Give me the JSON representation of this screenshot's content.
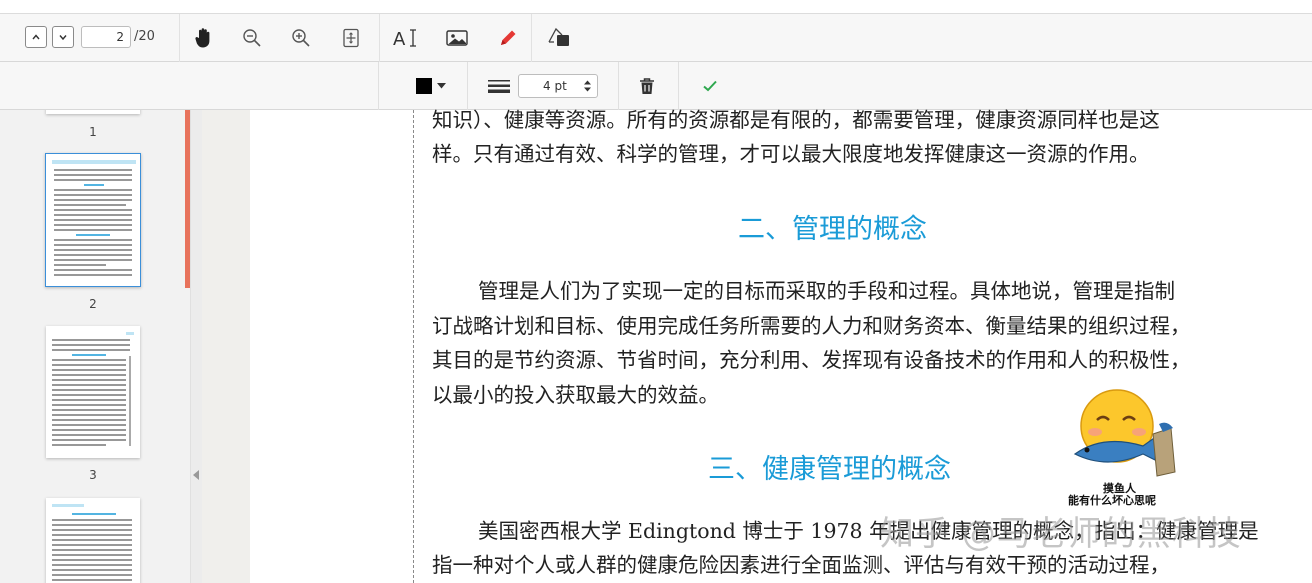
{
  "toolbar": {
    "page_current": "2",
    "page_total": "/20",
    "tools": [
      "prev-page",
      "next-page",
      "hand",
      "zoom-out",
      "zoom-in",
      "fit-page",
      "add-text",
      "add-image",
      "draw",
      "shape-fill"
    ]
  },
  "subtoolbar": {
    "stroke_color": "#000000",
    "stroke_width": "4 pt"
  },
  "sidebar": {
    "thumbnails": [
      {
        "label": "1"
      },
      {
        "label": "2"
      },
      {
        "label": "3"
      },
      {
        "label": ""
      }
    ]
  },
  "document": {
    "para1_line1": "知识）、健康等资源。所有的资源都是有限的，都需要管理，健康资源同样也是这",
    "para1_line2": "样。只有通过有效、科学的管理，才可以最大限度地发挥健康这一资源的作用。",
    "heading2": "二、管理的概念",
    "para2_line1": "管理是人们为了实现一定的目标而采取的手段和过程。具体地说，管理是指制",
    "para2_line2": "订战略计划和目标、使用完成任务所需要的人力和财务资本、衡量结果的组织过程，",
    "para2_line3": "其目的是节约资源、节省时间，充分利用、发挥现有设备技术的作用和人的积极性，",
    "para2_line4": "以最小的投入获取最大的效益。",
    "heading3": "三、健康管理的概念",
    "para3_line1": "美国密西根大学 Edingtond 博士于 1978 年提出健康管理的概念，指出：健康管理是",
    "para3_line2": "指一种对个人或人群的健康危险因素进行全面监测、评估与有效干预的活动过程，"
  },
  "overlay": {
    "sticker_line1": "摸鱼人",
    "sticker_line2": "能有什么坏心思呢",
    "watermark": "知乎 @马老师的黑科技"
  },
  "colors": {
    "heading": "#1a9bd7",
    "scroll_accent": "#e8735c",
    "confirm": "#2fa84f",
    "draw": "#e53935"
  }
}
